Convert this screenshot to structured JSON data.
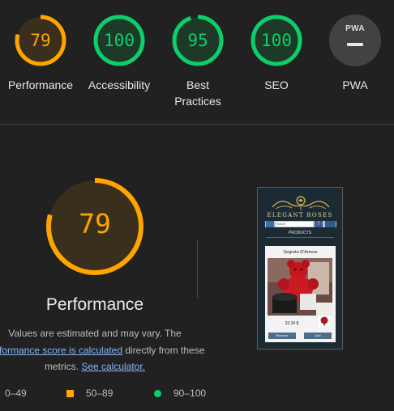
{
  "categories": [
    {
      "label": "Performance",
      "score": "79",
      "color": "#ffa400",
      "bg": "#3a2f1c",
      "fraction": 0.79
    },
    {
      "label": "Accessibility",
      "score": "100",
      "color": "#0cce6b",
      "bg": "#1c3a27",
      "fraction": 1.0
    },
    {
      "label": "Best Practices",
      "score": "95",
      "color": "#0cce6b",
      "bg": "#1c3a27",
      "fraction": 0.95
    },
    {
      "label": "SEO",
      "score": "100",
      "color": "#0cce6b",
      "bg": "#1c3a27",
      "fraction": 1.0
    }
  ],
  "pwa": {
    "label": "PWA",
    "badge": "PWA",
    "icon": "pwa-dash-icon"
  },
  "detail": {
    "score": "79",
    "fraction": 0.79,
    "title": "Performance",
    "desc_prefix": "Values are estimated and may vary. The ",
    "desc_link1": "performance score is calculated",
    "desc_mid": " directly from these metrics. ",
    "desc_link2": "See calculator."
  },
  "legend": [
    {
      "range": "0–49",
      "color": "#ff4e42",
      "shape": "triangle"
    },
    {
      "range": "50–89",
      "color": "#ffa400",
      "shape": "square"
    },
    {
      "range": "90–100",
      "color": "#0cce6b",
      "shape": "circle"
    }
  ],
  "thumbnail": {
    "brand": "ELEGANT ROSES",
    "search_placeholder": "Search",
    "fb_icon": "f",
    "section": "PRODUCTS",
    "product_name": "Segreto D'Amore",
    "price": "33.34 $",
    "remove_label": "Remove",
    "add_label": "Add"
  }
}
